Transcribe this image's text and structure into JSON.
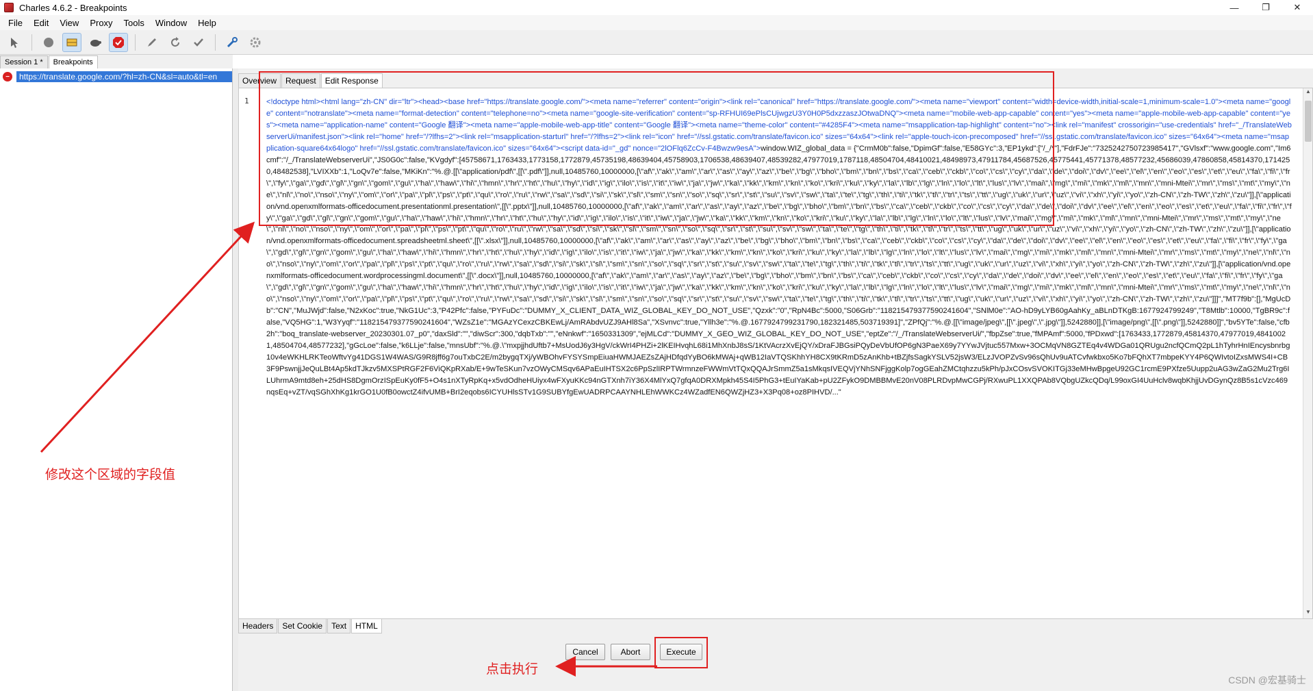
{
  "window": {
    "title": "Charles 4.6.2 - Breakpoints",
    "controls": [
      "—",
      "❐",
      "✕"
    ]
  },
  "menu": [
    "File",
    "Edit",
    "View",
    "Proxy",
    "Tools",
    "Window",
    "Help"
  ],
  "toolbar": {
    "icons": [
      "pointer-icon",
      "record-icon",
      "throttle-icon",
      "turtle-icon",
      "breakpoint-icon",
      "pen-icon",
      "refresh-icon",
      "check-icon",
      "tools-icon",
      "settings-icon"
    ]
  },
  "session_tabs": [
    "Session 1 *",
    "Breakpoints"
  ],
  "left": {
    "url": "https://translate.google.com/?hl=zh-CN&sl=auto&tl=en"
  },
  "request_tabs": [
    "Overview",
    "Request",
    "Edit Response"
  ],
  "editor": {
    "line_number": "1",
    "highlighted": "<!doctype html><html lang=\"zh-CN\" dir=\"ltr\"><head><base href=\"https://translate.google.com/\"><meta name=\"referrer\" content=\"origin\"><link rel=\"canonical\" href=\"https://translate.google.com/\"><meta name=\"viewport\" content=\"width=device-width,initial-scale=1,minimum-scale=1.0\"><meta name=\"google\" content=\"notranslate\"><meta name=\"format-detection\" content=\"telephone=no\"><meta name=\"google-site-verification\" content=\"sp-RFHUI69ePlsCUjwgzU3Y0H0P5dxzzaszJOtwaDNQ\"><meta name=\"mobile-web-app-capable\" content=\"yes\"><meta name=\"apple-mobile-web-app-capable\" content=\"yes\"><meta name=\"application-name\" content=\"Google 翻译\"><meta name=\"apple-mobile-web-app-title\" content=\"Google 翻译\"><meta name=\"theme-color\" content=\"#4285F4\"><meta name=\"msapplication-tap-highlight\" content=\"no\"><link rel=\"manifest\" crossorigin=\"use-credentials\" href=\"_/TranslateWebserverUi/manifest.json\"><link rel=\"home\" href=\"/?lfhs=2\"><link rel=\"msapplication-starturl\" href=\"/?lfhs=2\"><link rel=\"icon\" href=\"//ssl.gstatic.com/translate/favicon.ico\" sizes=\"64x64\"><link rel=\"apple-touch-icon-precomposed\" href=\"//ssl.gstatic.com/translate/favicon.ico\" sizes=\"64x64\"><meta name=\"msapplication-square64x64logo\" href=\"//ssl.gstatic.com/translate/favicon.ico\" sizes=\"64x64\"><script data-id=\"_gd\" nonce=\"2lOFlq6ZcCv-F4Bwzw9esA\">",
    "body": "window.WIZ_global_data = {\"CrmM0b\":false,\"DpimGf\":false,\"E58GYc\":3,\"EP1ykd\":[\"/_/*\"],\"FdrFJe\":\"7325242750723985417\",\"GVlsxf\":\"www.google.com\",\"Im6cmf\":\"/_/TranslateWebserverUi\",\"JS0G0c\":false,\"KVgdyf\":[45758671,1763433,1773158,1772879,45735198,48639404,45758903,1706538,48639407,48539282,47977019,1787118,48504704,48410021,48498973,47911784,45687526,45775441,45771378,48577232,45686039,47860858,45814370,1714250,48482538],\"LVIXXb\":1,\"LoQv7e\":false,\"MKiKn\":\"%.@.[[\\\"application/pdf\\\",[[\\\".pdf\\\"]],null,10485760,10000000,[\\\"af\\\",\\\"ak\\\",\\\"am\\\",\\\"ar\\\",\\\"as\\\",\\\"ay\\\",\\\"az\\\",\\\"be\\\",\\\"bg\\\",\\\"bho\\\",\\\"bm\\\",\\\"bn\\\",\\\"bs\\\",\\\"ca\\\",\\\"ceb\\\",\\\"ckb\\\",\\\"co\\\",\\\"cs\\\",\\\"cy\\\",\\\"da\\\",\\\"de\\\",\\\"doi\\\",\\\"dv\\\",\\\"ee\\\",\\\"el\\\",\\\"en\\\",\\\"eo\\\",\\\"es\\\",\\\"et\\\",\\\"eu\\\",\\\"fa\\\",\\\"fi\\\",\\\"fr\\\",\\\"fy\\\",\\\"ga\\\",\\\"gd\\\",\\\"gl\\\",\\\"gn\\\",\\\"gom\\\",\\\"gu\\\",\\\"ha\\\",\\\"haw\\\",\\\"hi\\\",\\\"hmn\\\",\\\"hr\\\",\\\"ht\\\",\\\"hu\\\",\\\"hy\\\",\\\"id\\\",\\\"ig\\\",\\\"ilo\\\",\\\"is\\\",\\\"it\\\",\\\"iw\\\",\\\"ja\\\",\\\"jw\\\",\\\"ka\\\",\\\"kk\\\",\\\"km\\\",\\\"kn\\\",\\\"ko\\\",\\\"kri\\\",\\\"ku\\\",\\\"ky\\\",\\\"la\\\",\\\"lb\\\",\\\"lg\\\",\\\"ln\\\",\\\"lo\\\",\\\"lt\\\",\\\"lus\\\",\\\"lv\\\",\\\"mai\\\",\\\"mg\\\",\\\"mi\\\",\\\"mk\\\",\\\"ml\\\",\\\"mn\\\",\\\"mni-Mtei\\\",\\\"mr\\\",\\\"ms\\\",\\\"mt\\\",\\\"my\\\",\\\"ne\\\",\\\"nl\\\",\\\"no\\\",\\\"nso\\\",\\\"ny\\\",\\\"om\\\",\\\"or\\\",\\\"pa\\\",\\\"pl\\\",\\\"ps\\\",\\\"pt\\\",\\\"qu\\\",\\\"ro\\\",\\\"ru\\\",\\\"rw\\\",\\\"sa\\\",\\\"sd\\\",\\\"si\\\",\\\"sk\\\",\\\"sl\\\",\\\"sm\\\",\\\"sn\\\",\\\"so\\\",\\\"sq\\\",\\\"sr\\\",\\\"st\\\",\\\"su\\\",\\\"sv\\\",\\\"sw\\\",\\\"ta\\\",\\\"te\\\",\\\"tg\\\",\\\"th\\\",\\\"ti\\\",\\\"tk\\\",\\\"tl\\\",\\\"tr\\\",\\\"ts\\\",\\\"tt\\\",\\\"ug\\\",\\\"uk\\\",\\\"ur\\\",\\\"uz\\\",\\\"vi\\\",\\\"xh\\\",\\\"yi\\\",\\\"yo\\\",\\\"zh-CN\\\",\\\"zh-TW\\\",\\\"zh\\\",\\\"zu\\\"]],[\\\"application/vnd.openxmlformats-officedocument.presentationml.presentation\\\",[[\\\".pptx\\\"]],null,10485760,10000000,[\\\"af\\\",\\\"ak\\\",\\\"am\\\",\\\"ar\\\",\\\"as\\\",\\\"ay\\\",\\\"az\\\",\\\"be\\\",\\\"bg\\\",\\\"bho\\\",\\\"bm\\\",\\\"bn\\\",\\\"bs\\\",\\\"ca\\\",\\\"ceb\\\",\\\"ckb\\\",\\\"co\\\",\\\"cs\\\",\\\"cy\\\",\\\"da\\\",\\\"de\\\",\\\"doi\\\",\\\"dv\\\",\\\"ee\\\",\\\"el\\\",\\\"en\\\",\\\"eo\\\",\\\"es\\\",\\\"et\\\",\\\"eu\\\",\\\"fa\\\",\\\"fi\\\",\\\"fr\\\",\\\"fy\\\",\\\"ga\\\",\\\"gd\\\",\\\"gl\\\",\\\"gn\\\",\\\"gom\\\",\\\"gu\\\",\\\"ha\\\",\\\"haw\\\",\\\"hi\\\",\\\"hmn\\\",\\\"hr\\\",\\\"ht\\\",\\\"hu\\\",\\\"hy\\\",\\\"id\\\",\\\"ig\\\",\\\"ilo\\\",\\\"is\\\",\\\"it\\\",\\\"iw\\\",\\\"ja\\\",\\\"jw\\\",\\\"ka\\\",\\\"kk\\\",\\\"km\\\",\\\"kn\\\",\\\"ko\\\",\\\"kri\\\",\\\"ku\\\",\\\"ky\\\",\\\"la\\\",\\\"lb\\\",\\\"lg\\\",\\\"ln\\\",\\\"lo\\\",\\\"lt\\\",\\\"lus\\\",\\\"lv\\\",\\\"mai\\\",\\\"mg\\\",\\\"mi\\\",\\\"mk\\\",\\\"ml\\\",\\\"mn\\\",\\\"mni-Mtei\\\",\\\"mr\\\",\\\"ms\\\",\\\"mt\\\",\\\"my\\\",\\\"ne\\\",\\\"nl\\\",\\\"no\\\",\\\"nso\\\",\\\"ny\\\",\\\"om\\\",\\\"or\\\",\\\"pa\\\",\\\"pl\\\",\\\"ps\\\",\\\"pt\\\",\\\"qu\\\",\\\"ro\\\",\\\"ru\\\",\\\"rw\\\",\\\"sa\\\",\\\"sd\\\",\\\"si\\\",\\\"sk\\\",\\\"sl\\\",\\\"sm\\\",\\\"sn\\\",\\\"so\\\",\\\"sq\\\",\\\"sr\\\",\\\"st\\\",\\\"su\\\",\\\"sv\\\",\\\"sw\\\",\\\"ta\\\",\\\"te\\\",\\\"tg\\\",\\\"th\\\",\\\"ti\\\",\\\"tk\\\",\\\"tl\\\",\\\"tr\\\",\\\"ts\\\",\\\"tt\\\",\\\"ug\\\",\\\"uk\\\",\\\"ur\\\",\\\"uz\\\",\\\"vi\\\",\\\"xh\\\",\\\"yi\\\",\\\"yo\\\",\\\"zh-CN\\\",\\\"zh-TW\\\",\\\"zh\\\",\\\"zu\\\"]],[\\\"application/vnd.openxmlformats-officedocument.spreadsheetml.sheet\\\",[[\\\".xlsx\\\"]],null,10485760,10000000,[\\\"af\\\",\\\"ak\\\",\\\"am\\\",\\\"ar\\\",\\\"as\\\",\\\"ay\\\",\\\"az\\\",\\\"be\\\",\\\"bg\\\",\\\"bho\\\",\\\"bm\\\",\\\"bn\\\",\\\"bs\\\",\\\"ca\\\",\\\"ceb\\\",\\\"ckb\\\",\\\"co\\\",\\\"cs\\\",\\\"cy\\\",\\\"da\\\",\\\"de\\\",\\\"doi\\\",\\\"dv\\\",\\\"ee\\\",\\\"el\\\",\\\"en\\\",\\\"eo\\\",\\\"es\\\",\\\"et\\\",\\\"eu\\\",\\\"fa\\\",\\\"fi\\\",\\\"fr\\\",\\\"fy\\\",\\\"ga\\\",\\\"gd\\\",\\\"gl\\\",\\\"gn\\\",\\\"gom\\\",\\\"gu\\\",\\\"ha\\\",\\\"haw\\\",\\\"hi\\\",\\\"hmn\\\",\\\"hr\\\",\\\"ht\\\",\\\"hu\\\",\\\"hy\\\",\\\"id\\\",\\\"ig\\\",\\\"ilo\\\",\\\"is\\\",\\\"it\\\",\\\"iw\\\",\\\"ja\\\",\\\"jw\\\",\\\"ka\\\",\\\"kk\\\",\\\"km\\\",\\\"kn\\\",\\\"ko\\\",\\\"kri\\\",\\\"ku\\\",\\\"ky\\\",\\\"la\\\",\\\"lb\\\",\\\"lg\\\",\\\"ln\\\",\\\"lo\\\",\\\"lt\\\",\\\"lus\\\",\\\"lv\\\",\\\"mai\\\",\\\"mg\\\",\\\"mi\\\",\\\"mk\\\",\\\"ml\\\",\\\"mn\\\",\\\"mni-Mtei\\\",\\\"mr\\\",\\\"ms\\\",\\\"mt\\\",\\\"my\\\",\\\"ne\\\",\\\"nl\\\",\\\"no\\\",\\\"nso\\\",\\\"ny\\\",\\\"om\\\",\\\"or\\\",\\\"pa\\\",\\\"pl\\\",\\\"ps\\\",\\\"pt\\\",\\\"qu\\\",\\\"ro\\\",\\\"ru\\\",\\\"rw\\\",\\\"sa\\\",\\\"sd\\\",\\\"si\\\",\\\"sk\\\",\\\"sl\\\",\\\"sm\\\",\\\"sn\\\",\\\"so\\\",\\\"sq\\\",\\\"sr\\\",\\\"st\\\",\\\"su\\\",\\\"sv\\\",\\\"sw\\\",\\\"ta\\\",\\\"te\\\",\\\"tg\\\",\\\"th\\\",\\\"ti\\\",\\\"tk\\\",\\\"tl\\\",\\\"tr\\\",\\\"ts\\\",\\\"tt\\\",\\\"ug\\\",\\\"uk\\\",\\\"ur\\\",\\\"uz\\\",\\\"vi\\\",\\\"xh\\\",\\\"yi\\\",\\\"yo\\\",\\\"zh-CN\\\",\\\"zh-TW\\\",\\\"zh\\\",\\\"zu\\\"]],[\\\"application/vnd.openxmlformats-officedocument.wordprocessingml.document\\\",[[\\\".docx\\\"]],null,10485760,10000000,[\\\"af\\\",\\\"ak\\\",\\\"am\\\",\\\"ar\\\",\\\"as\\\",\\\"ay\\\",\\\"az\\\",\\\"be\\\",\\\"bg\\\",\\\"bho\\\",\\\"bm\\\",\\\"bn\\\",\\\"bs\\\",\\\"ca\\\",\\\"ceb\\\",\\\"ckb\\\",\\\"co\\\",\\\"cs\\\",\\\"cy\\\",\\\"da\\\",\\\"de\\\",\\\"doi\\\",\\\"dv\\\",\\\"ee\\\",\\\"el\\\",\\\"en\\\",\\\"eo\\\",\\\"es\\\",\\\"et\\\",\\\"eu\\\",\\\"fa\\\",\\\"fi\\\",\\\"fr\\\",\\\"fy\\\",\\\"ga\\\",\\\"gd\\\",\\\"gl\\\",\\\"gn\\\",\\\"gom\\\",\\\"gu\\\",\\\"ha\\\",\\\"haw\\\",\\\"hi\\\",\\\"hmn\\\",\\\"hr\\\",\\\"ht\\\",\\\"hu\\\",\\\"hy\\\",\\\"id\\\",\\\"ig\\\",\\\"ilo\\\",\\\"is\\\",\\\"it\\\",\\\"iw\\\",\\\"ja\\\",\\\"jw\\\",\\\"ka\\\",\\\"kk\\\",\\\"km\\\",\\\"kn\\\",\\\"ko\\\",\\\"kri\\\",\\\"ku\\\",\\\"ky\\\",\\\"la\\\",\\\"lb\\\",\\\"lg\\\",\\\"ln\\\",\\\"lo\\\",\\\"lt\\\",\\\"lus\\\",\\\"lv\\\",\\\"mai\\\",\\\"mg\\\",\\\"mi\\\",\\\"mk\\\",\\\"ml\\\",\\\"mn\\\",\\\"mni-Mtei\\\",\\\"mr\\\",\\\"ms\\\",\\\"mt\\\",\\\"my\\\",\\\"ne\\\",\\\"nl\\\",\\\"no\\\",\\\"nso\\\",\\\"ny\\\",\\\"om\\\",\\\"or\\\",\\\"pa\\\",\\\"pl\\\",\\\"ps\\\",\\\"pt\\\",\\\"qu\\\",\\\"ro\\\",\\\"ru\\\",\\\"rw\\\",\\\"sa\\\",\\\"sd\\\",\\\"si\\\",\\\"sk\\\",\\\"sl\\\",\\\"sm\\\",\\\"sn\\\",\\\"so\\\",\\\"sq\\\",\\\"sr\\\",\\\"st\\\",\\\"su\\\",\\\"sv\\\",\\\"sw\\\",\\\"ta\\\",\\\"te\\\",\\\"tg\\\",\\\"th\\\",\\\"ti\\\",\\\"tk\\\",\\\"tl\\\",\\\"tr\\\",\\\"ts\\\",\\\"tt\\\",\\\"ug\\\",\\\"uk\\\",\\\"ur\\\",\\\"uz\\\",\\\"vi\\\",\\\"xh\\\",\\\"yi\\\",\\\"yo\\\",\\\"zh-CN\\\",\\\"zh-TW\\\",\\\"zh\\\",\\\"zu\\\"]]]\",\"MT7f9b\":[],\"MgUcDb\":\"CN\",\"MuJWjd\":false,\"N2xKoc\":true,\"NkG1Uc\":3,\"P42Pfc\":false,\"PYFuDc\":\"DUMMY_X_CLIENT_DATA_WIZ_GLOBAL_KEY_DO_NOT_USE\",\"Qzxk\":\"0\",\"RpN4Bc\":5000,\"S06Grb\":\"118215479377590241604\",\"SNlM0e\":\"AO-hD9yLYB60gAahKy_aBLnDTKgB:1677924799249\",\"T8Mtlb\":10000,\"TgBR9c\":false,\"VQ5HG\":1,\"W3Yyqf\":\"118215479377590241604\",\"WZsZ1e\":\"MGAzYCexzCBKEwLj/AmRAbdvUZJ9AHl8Sa\",\"XSvnvc\":true,\"Yllh3e\":\"%.@.1677924799231790,182321485,503719391]\",\"ZPfQj\":\"%.@.[[\\\"image/jpeg\\\",[[\\\".jpeg\\\",\\\".jpg\\\"]],5242880]],[\\\"image/png\\\",[[\\\".png\\\"]],5242880]]\",\"bv5YTe\":false,\"cfb2h\":\"boq_translate-webserver_20230301.07_p0\",\"daxSld\":\"\",\"diwScr\":300,\"dqbTxb\":\"\",\"eNnkwf\":\"1650331309\",\"ejMLCd\":\"DUMMY_X_GEO_WIZ_GLOBAL_KEY_DO_NOT_USE\",\"eptZe\":\"/_/TranslateWebserverUi/\",\"fbpZse\":true,\"fMPAmf\":5000,\"fPDxwd\":[1763433,1772879,45814370,47977019,48410021,48504704,48577232],\"gGcLoe\":false,\"k6LLje\":false,\"mnsUbf\":\"%.@.\\\"mxpjjhdUftb7+MsUodJ6y3HgV/ckWrI4PHZi+2lKEIHvqhL68i1MhXnbJ8sS/1KtVAcrzXvEjQY/xDraFJBGsiPQyDeVbUfOP6gN3PaeX69y7YYwJVjtuc557Mxw+3OCMqVN8GZTEq4v4WDGa01QRUgu2ncfQCmQ2pL1hTyhrHnIEncysbnrbg10v4eWKHLRKTeoWftvYg41DGS1W4WAS/G9R8jff6g7ouTxbC2E/m2bygqTXj/yWBOhvFYSYSmpEiuaHWMJAEZsZAjHDfqdYyBO6kMWAj+qWB12IaVTQSKhhYH8CX9tKRmD5zAnKhb+tBZjfsSagkYSLV52jsW3/ELzJVOPZvSv96sQhUv9uATCvfwkbxo5Ko7bFQhXT7mbpeKYY4P6QWIvtoIZxsMWS4I+CB3F9PswnjjJeQuLBt4Ap5kdTJkzv5MXSPtRGF2F6ViQKpRXab/E+9wTeSKun7vzOWyCMSqv6APaEuIHTSX2c6PpSzlIRPTWrmnzeFWWmVtTQxQQAJrSmmZ5a1sMkqsIVEQVjYNhSNFjggKolp7ogGEahZMCtqhzzu5kPh/pJxCOsvSVOKITGj33eMHwBpgeU92GC1rcmE9PXfze5Uupp2uAG3wZaG2Mu2Trg6ILUhrmA9mtd8eh+25dHS8DgmOrzISpEuKy0fF5+O4s1nXTyRpKq+x5vdOdheHUiyx4wFXyuKKc94nGTXnh7iY36X4MlYxQ7gfqA0DRXMpkh45S4I5PhG3+tEuIYaKab+pU2ZFykO9DMBBMvE20nV08PLRDvpMwCGPj/RXwuPL1XXQPAb8VQbgUZkcQDq/L99oxGI4UuHclv8wqbKhjjUvDGynQz8B5s1cVzc469nqsEq+vZT/vqSGhXhKg1krGO1U0fB0owctZ4ifvUMB+BrI2eqobs6ICYUHlsSTv1G9SUBYfgEwUADRPCAAYNHLEhWWKCz4WZadfEN6QWZjHZ3+X3Pq08+oz8PIHVD/...\""
  },
  "bottom_tabs": [
    "Headers",
    "Set Cookie",
    "Text",
    "HTML"
  ],
  "buttons": {
    "cancel": "Cancel",
    "abort": "Abort",
    "execute": "Execute"
  },
  "annotations": {
    "edit_region": "修改这个区域的字段值",
    "click_execute": "点击执行",
    "accent_color": "#e02020"
  },
  "watermark": "CSDN @宏基骑士"
}
